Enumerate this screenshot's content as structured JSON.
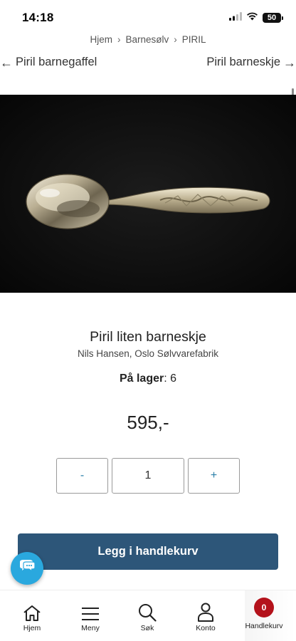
{
  "status": {
    "time": "14:18",
    "battery": "50"
  },
  "breadcrumb": {
    "items": [
      "Hjem",
      "Barnesølv",
      "PIRIL"
    ],
    "separator": "›"
  },
  "product_nav": {
    "prev_label": "Piril barnegaffel",
    "next_label": "Piril barneskje",
    "prev_arrow": "←",
    "next_arrow": "→"
  },
  "product": {
    "title": "Piril liten barneskje",
    "maker": "Nils Hansen, Oslo Sølvvarefabrik",
    "stock_label": "På lager",
    "stock_count": "6",
    "price": "595,-"
  },
  "quantity": {
    "minus": "-",
    "value": "1",
    "plus": "+"
  },
  "cart": {
    "add_label": "Legg i handlekurv",
    "count": "0"
  },
  "bottom_nav": {
    "home": "Hjem",
    "menu": "Meny",
    "search": "Søk",
    "account": "Konto",
    "cart": "Handlekurv"
  },
  "colors": {
    "primary": "#2d5679",
    "accent": "#2a7fa8",
    "chat": "#2aa8de",
    "badge": "#b4121b"
  },
  "icons": [
    "signal-icon",
    "wifi-icon",
    "battery-icon",
    "chat-icon",
    "home-icon",
    "menu-icon",
    "search-icon",
    "user-icon",
    "cart-icon"
  ]
}
